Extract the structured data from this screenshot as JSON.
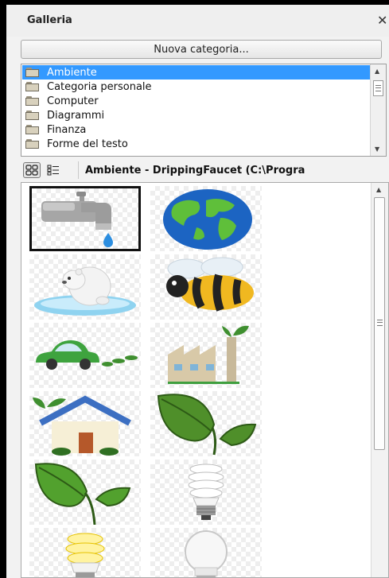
{
  "panel": {
    "title": "Galleria",
    "close_glyph": "✕"
  },
  "new_category_button": "Nuova categoria...",
  "categories": [
    {
      "label": "Ambiente",
      "selected": true,
      "icon": "folder-icon"
    },
    {
      "label": "Categoria personale",
      "selected": false,
      "icon": "folder-icon"
    },
    {
      "label": "Computer",
      "selected": false,
      "icon": "folder-icon"
    },
    {
      "label": "Diagrammi",
      "selected": false,
      "icon": "folder-icon"
    },
    {
      "label": "Finanza",
      "selected": false,
      "icon": "folder-icon"
    },
    {
      "label": "Forme del testo",
      "selected": false,
      "icon": "folder-icon"
    }
  ],
  "toolbar": {
    "icon_view": "grid-view-icon",
    "detail_view": "list-view-icon",
    "path": "Ambiente - DrippingFaucet (C:\\Progra"
  },
  "gallery_items": [
    {
      "name": "dripping-faucet",
      "selected": true
    },
    {
      "name": "globe"
    },
    {
      "name": "polar-bear"
    },
    {
      "name": "bee"
    },
    {
      "name": "green-car"
    },
    {
      "name": "factory-with-plant"
    },
    {
      "name": "green-house"
    },
    {
      "name": "leaf-sprout"
    },
    {
      "name": "seedling"
    },
    {
      "name": "energy-saving-bulb"
    },
    {
      "name": "yellow-cfl-bulb"
    },
    {
      "name": "light-bulb"
    }
  ],
  "colors": {
    "selection": "#3399ff",
    "panel_bg": "#f2f2f2"
  }
}
